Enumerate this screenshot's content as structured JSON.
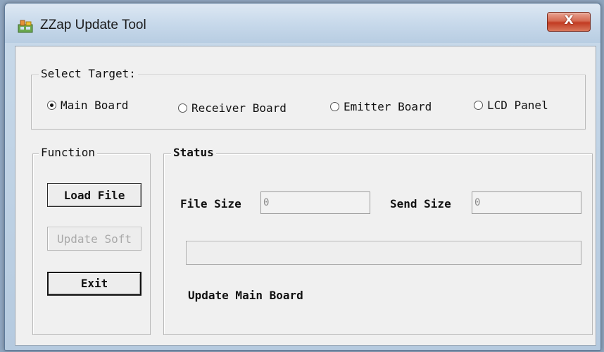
{
  "window": {
    "title": "ZZap Update Tool",
    "close_label": "X"
  },
  "target_group": {
    "label": "Select Target:",
    "options": [
      {
        "label": "Main Board",
        "checked": true
      },
      {
        "label": "Receiver Board",
        "checked": false
      },
      {
        "label": "Emitter Board",
        "checked": false
      },
      {
        "label": "LCD Panel",
        "checked": false
      }
    ]
  },
  "function_group": {
    "label": "Function",
    "load_file": "Load File",
    "update_soft": "Update Soft",
    "exit": "Exit"
  },
  "status_group": {
    "label": "Status",
    "file_size_label": "File Size",
    "file_size_value": "0",
    "send_size_label": "Send Size",
    "send_size_value": "0",
    "progress": 0,
    "status_text": "Update Main Board"
  },
  "colors": {
    "close_button": "#c23b22",
    "window_frame": "#b5cadf",
    "client_bg": "#f0f0f0"
  }
}
